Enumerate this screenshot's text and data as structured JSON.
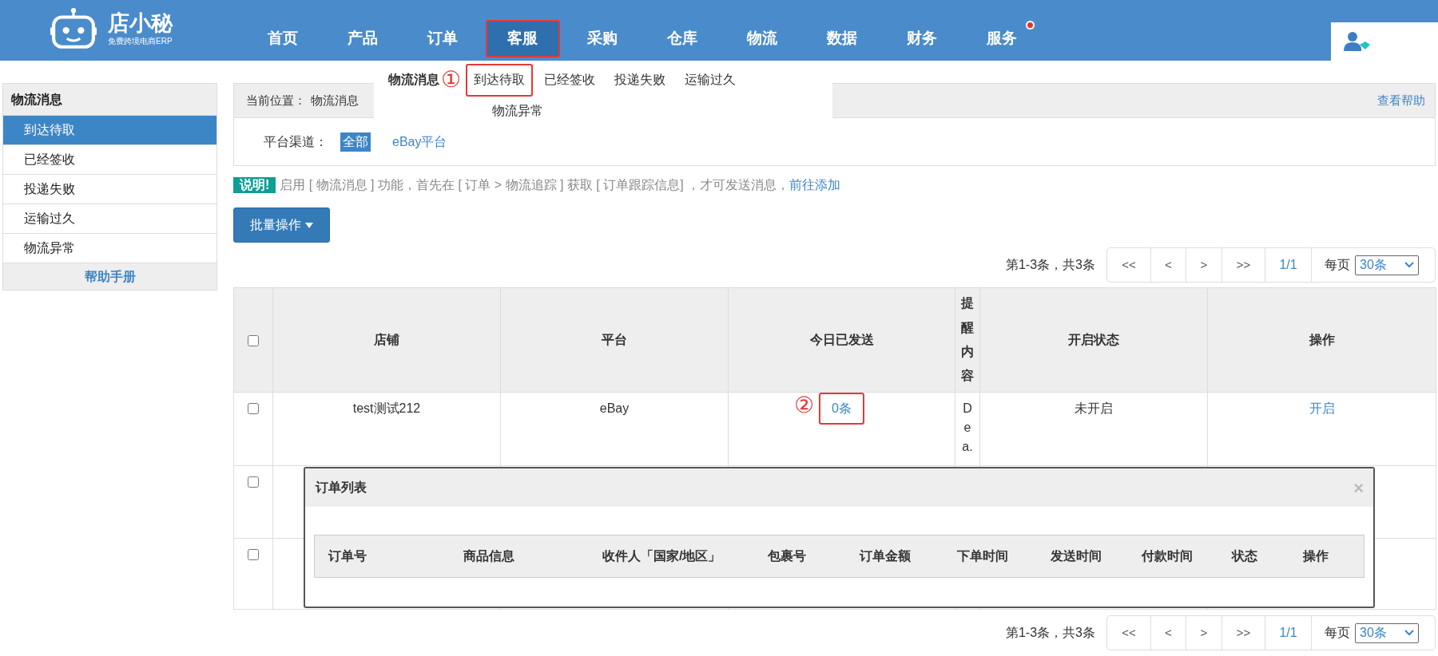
{
  "header": {
    "logo": {
      "name": "店小秘",
      "tagline": "免费跨境电商ERP"
    },
    "nav": [
      {
        "label": "首页",
        "selected": false,
        "notification": false
      },
      {
        "label": "产品",
        "selected": false,
        "notification": false
      },
      {
        "label": "订单",
        "selected": false,
        "notification": false
      },
      {
        "label": "客服",
        "selected": true,
        "notification": false
      },
      {
        "label": "采购",
        "selected": false,
        "notification": false
      },
      {
        "label": "仓库",
        "selected": false,
        "notification": false
      },
      {
        "label": "物流",
        "selected": false,
        "notification": false
      },
      {
        "label": "数据",
        "selected": false,
        "notification": false
      },
      {
        "label": "财务",
        "selected": false,
        "notification": false
      },
      {
        "label": "服务",
        "selected": false,
        "notification": true
      }
    ]
  },
  "dropdown": {
    "title": "物流消息",
    "marker": "①",
    "items": [
      {
        "label": "到达待取",
        "highlighted": true
      },
      {
        "label": "已经签收",
        "highlighted": false
      },
      {
        "label": "投递失败",
        "highlighted": false
      },
      {
        "label": "运输过久",
        "highlighted": false
      },
      {
        "label": "物流异常",
        "highlighted": false
      }
    ]
  },
  "sidebar": {
    "title": "物流消息",
    "items": [
      {
        "label": "到达待取",
        "selected": true
      },
      {
        "label": "已经签收",
        "selected": false
      },
      {
        "label": "投递失败",
        "selected": false
      },
      {
        "label": "运输过久",
        "selected": false
      },
      {
        "label": "物流异常",
        "selected": false
      }
    ],
    "footer": "帮助手册"
  },
  "breadcrumb": {
    "label": "当前位置：",
    "path": "物流消息",
    "help": "查看帮助"
  },
  "filter": {
    "label": "平台渠道：",
    "options": [
      {
        "label": "全部",
        "selected": true
      },
      {
        "label": "eBay平台",
        "selected": false
      }
    ]
  },
  "notice": {
    "badge": "说明!",
    "text": "启用 [ 物流消息 ] 功能，首先在 [ 订单 > 物流追踪 ] 获取 [ 订单跟踪信息] ，才可发送消息，",
    "link": "前往添加"
  },
  "bulk_button": "批量操作",
  "pagination_top": {
    "summary": "第1-3条，共3条",
    "buttons": [
      "<<",
      "<",
      ">",
      ">>"
    ],
    "page": "1/1",
    "per_page_label": "每页",
    "per_page": "30条"
  },
  "table": {
    "select_all_checked": false,
    "columns": [
      "店铺",
      "平台",
      "今日已发送",
      "提醒内容",
      "开启状态",
      "操作"
    ],
    "rows": [
      {
        "checked": false,
        "store": "test测试212",
        "platform": "eBay",
        "sent_today": "0条",
        "sent_marker": "②",
        "highlighted": true,
        "reminder": "Dea.",
        "status": "未开启",
        "action": "开启"
      },
      {
        "checked": false
      },
      {
        "checked": false
      }
    ]
  },
  "modal": {
    "title": "订单列表",
    "close": "×",
    "columns": [
      "订单号",
      "商品信息",
      "收件人「国家/地区」",
      "包裹号",
      "订单金额",
      "下单时间",
      "发送时间",
      "付款时间",
      "状态",
      "操作"
    ]
  },
  "pagination_bottom": {
    "summary": "第1-3条，共3条",
    "buttons": [
      "<<",
      "<",
      ">",
      ">>"
    ],
    "page": "1/1",
    "per_page_label": "每页",
    "per_page": "30条"
  }
}
